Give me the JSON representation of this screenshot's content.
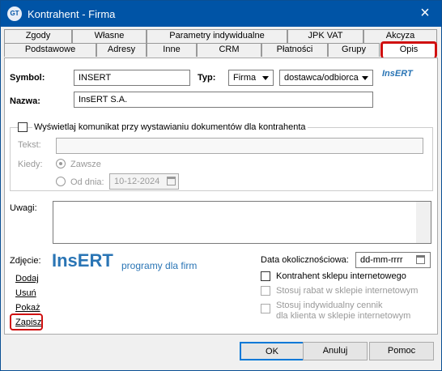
{
  "window": {
    "title": "Kontrahent - Firma",
    "icon_text": "GT"
  },
  "tabs": {
    "row1": [
      "Zgody",
      "Własne",
      "Parametry indywidualne",
      "JPK VAT",
      "Akcyza"
    ],
    "row2": [
      "Podstawowe",
      "Adresy",
      "Inne",
      "CRM",
      "Płatności",
      "Grupy",
      "Opis"
    ]
  },
  "form": {
    "symbol_label": "Symbol:",
    "symbol_value": "INSERT",
    "typ_label": "Typ:",
    "typ_value": "Firma",
    "rodzaj_value": "dostawca/odbiorca",
    "nazwa_label": "Nazwa:",
    "nazwa_value": "InsERT S.A.",
    "logo_small": "InsERT",
    "message_checkbox_label": "Wyświetlaj komunikat przy wystawianiu dokumentów dla kontrahenta",
    "tekst_label": "Tekst:",
    "kiedy_label": "Kiedy:",
    "zawsze_label": "Zawsze",
    "od_dnia_label": "Od dnia:",
    "date_value": "10-12-2024",
    "uwagi_label": "Uwagi:",
    "zdjecie_label": "Zdjęcie:",
    "image_brand": "InsERT",
    "image_tagline": "programy dla firm",
    "photo_actions": [
      "Dodaj",
      "Usuń",
      "Pokaż",
      "Zapisz"
    ],
    "data_label": "Data okolicznościowa:",
    "data_placeholder": "dd-mm-rrrr",
    "shop_checkbox": "Kontrahent sklepu internetowego",
    "rabat_checkbox": "Stosuj rabat w sklepie internetowym",
    "cennik_checkbox": "Stosuj indywidualny cennik",
    "cennik_checkbox_line2": "dla klienta w sklepie internetowym"
  },
  "buttons": {
    "ok": "OK",
    "cancel": "Anuluj",
    "help": "Pomoc"
  }
}
